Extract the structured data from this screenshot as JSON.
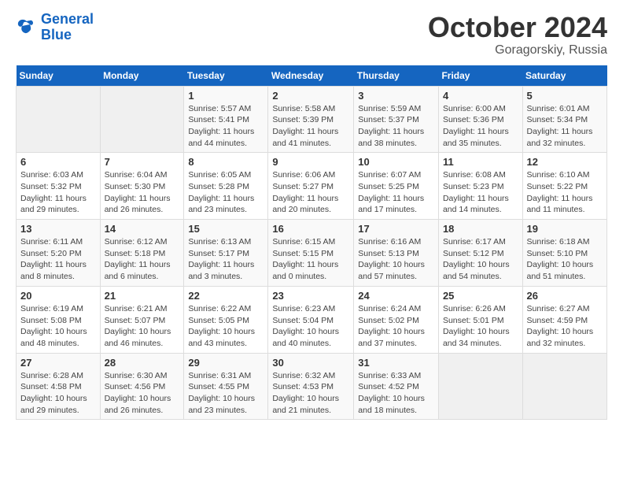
{
  "header": {
    "logo": {
      "line1": "General",
      "line2": "Blue"
    },
    "month": "October 2024",
    "location": "Goragorskiy, Russia"
  },
  "weekdays": [
    "Sunday",
    "Monday",
    "Tuesday",
    "Wednesday",
    "Thursday",
    "Friday",
    "Saturday"
  ],
  "weeks": [
    [
      {
        "day": "",
        "info": ""
      },
      {
        "day": "",
        "info": ""
      },
      {
        "day": "1",
        "info": "Sunrise: 5:57 AM\nSunset: 5:41 PM\nDaylight: 11 hours and 44 minutes."
      },
      {
        "day": "2",
        "info": "Sunrise: 5:58 AM\nSunset: 5:39 PM\nDaylight: 11 hours and 41 minutes."
      },
      {
        "day": "3",
        "info": "Sunrise: 5:59 AM\nSunset: 5:37 PM\nDaylight: 11 hours and 38 minutes."
      },
      {
        "day": "4",
        "info": "Sunrise: 6:00 AM\nSunset: 5:36 PM\nDaylight: 11 hours and 35 minutes."
      },
      {
        "day": "5",
        "info": "Sunrise: 6:01 AM\nSunset: 5:34 PM\nDaylight: 11 hours and 32 minutes."
      }
    ],
    [
      {
        "day": "6",
        "info": "Sunrise: 6:03 AM\nSunset: 5:32 PM\nDaylight: 11 hours and 29 minutes."
      },
      {
        "day": "7",
        "info": "Sunrise: 6:04 AM\nSunset: 5:30 PM\nDaylight: 11 hours and 26 minutes."
      },
      {
        "day": "8",
        "info": "Sunrise: 6:05 AM\nSunset: 5:28 PM\nDaylight: 11 hours and 23 minutes."
      },
      {
        "day": "9",
        "info": "Sunrise: 6:06 AM\nSunset: 5:27 PM\nDaylight: 11 hours and 20 minutes."
      },
      {
        "day": "10",
        "info": "Sunrise: 6:07 AM\nSunset: 5:25 PM\nDaylight: 11 hours and 17 minutes."
      },
      {
        "day": "11",
        "info": "Sunrise: 6:08 AM\nSunset: 5:23 PM\nDaylight: 11 hours and 14 minutes."
      },
      {
        "day": "12",
        "info": "Sunrise: 6:10 AM\nSunset: 5:22 PM\nDaylight: 11 hours and 11 minutes."
      }
    ],
    [
      {
        "day": "13",
        "info": "Sunrise: 6:11 AM\nSunset: 5:20 PM\nDaylight: 11 hours and 8 minutes."
      },
      {
        "day": "14",
        "info": "Sunrise: 6:12 AM\nSunset: 5:18 PM\nDaylight: 11 hours and 6 minutes."
      },
      {
        "day": "15",
        "info": "Sunrise: 6:13 AM\nSunset: 5:17 PM\nDaylight: 11 hours and 3 minutes."
      },
      {
        "day": "16",
        "info": "Sunrise: 6:15 AM\nSunset: 5:15 PM\nDaylight: 11 hours and 0 minutes."
      },
      {
        "day": "17",
        "info": "Sunrise: 6:16 AM\nSunset: 5:13 PM\nDaylight: 10 hours and 57 minutes."
      },
      {
        "day": "18",
        "info": "Sunrise: 6:17 AM\nSunset: 5:12 PM\nDaylight: 10 hours and 54 minutes."
      },
      {
        "day": "19",
        "info": "Sunrise: 6:18 AM\nSunset: 5:10 PM\nDaylight: 10 hours and 51 minutes."
      }
    ],
    [
      {
        "day": "20",
        "info": "Sunrise: 6:19 AM\nSunset: 5:08 PM\nDaylight: 10 hours and 48 minutes."
      },
      {
        "day": "21",
        "info": "Sunrise: 6:21 AM\nSunset: 5:07 PM\nDaylight: 10 hours and 46 minutes."
      },
      {
        "day": "22",
        "info": "Sunrise: 6:22 AM\nSunset: 5:05 PM\nDaylight: 10 hours and 43 minutes."
      },
      {
        "day": "23",
        "info": "Sunrise: 6:23 AM\nSunset: 5:04 PM\nDaylight: 10 hours and 40 minutes."
      },
      {
        "day": "24",
        "info": "Sunrise: 6:24 AM\nSunset: 5:02 PM\nDaylight: 10 hours and 37 minutes."
      },
      {
        "day": "25",
        "info": "Sunrise: 6:26 AM\nSunset: 5:01 PM\nDaylight: 10 hours and 34 minutes."
      },
      {
        "day": "26",
        "info": "Sunrise: 6:27 AM\nSunset: 4:59 PM\nDaylight: 10 hours and 32 minutes."
      }
    ],
    [
      {
        "day": "27",
        "info": "Sunrise: 6:28 AM\nSunset: 4:58 PM\nDaylight: 10 hours and 29 minutes."
      },
      {
        "day": "28",
        "info": "Sunrise: 6:30 AM\nSunset: 4:56 PM\nDaylight: 10 hours and 26 minutes."
      },
      {
        "day": "29",
        "info": "Sunrise: 6:31 AM\nSunset: 4:55 PM\nDaylight: 10 hours and 23 minutes."
      },
      {
        "day": "30",
        "info": "Sunrise: 6:32 AM\nSunset: 4:53 PM\nDaylight: 10 hours and 21 minutes."
      },
      {
        "day": "31",
        "info": "Sunrise: 6:33 AM\nSunset: 4:52 PM\nDaylight: 10 hours and 18 minutes."
      },
      {
        "day": "",
        "info": ""
      },
      {
        "day": "",
        "info": ""
      }
    ]
  ]
}
